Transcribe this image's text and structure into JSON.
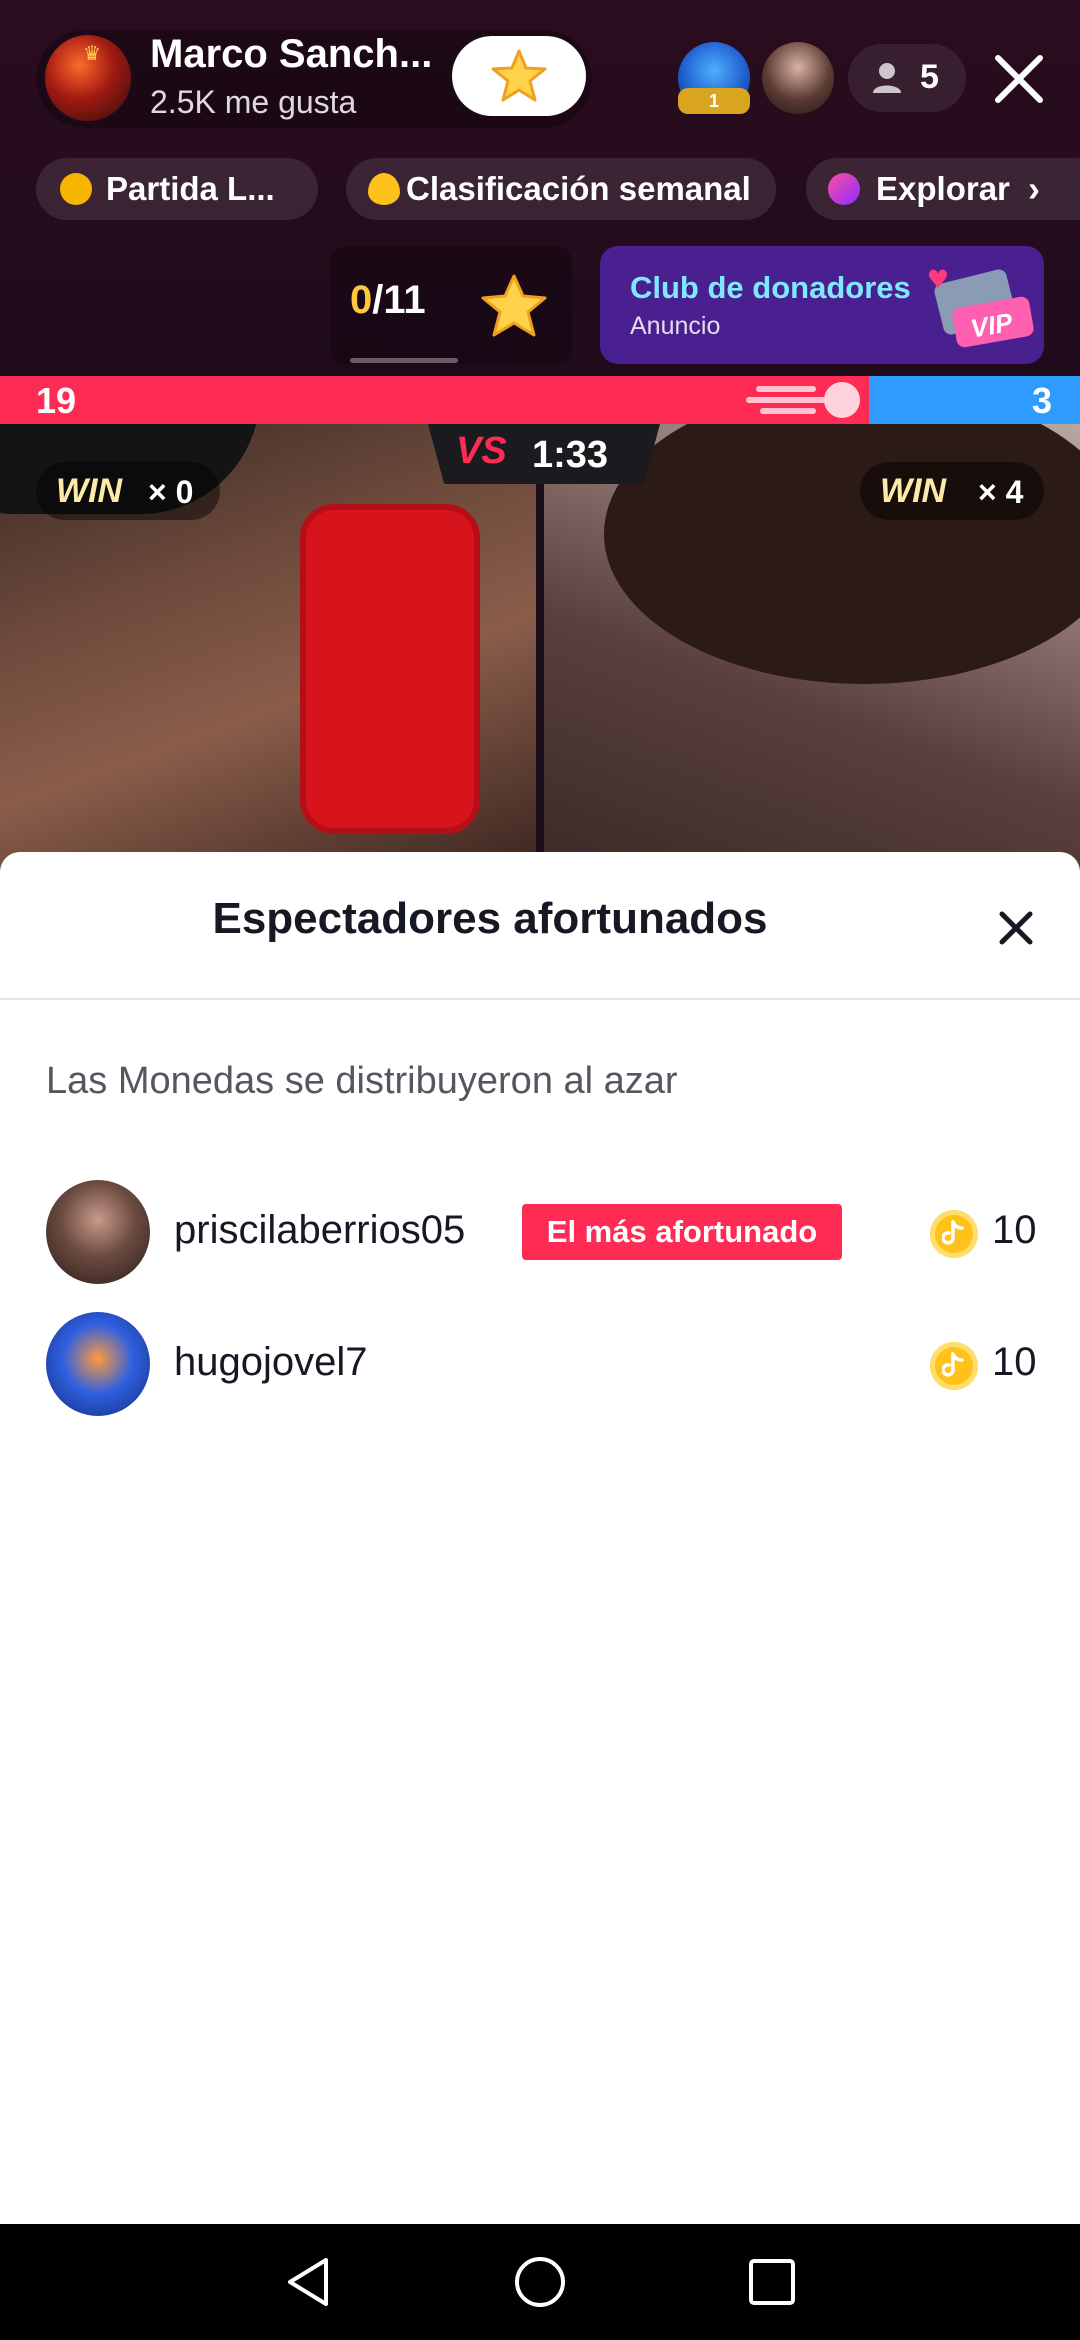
{
  "host": {
    "name": "Marco Sanch...",
    "likes": "2.5K me gusta"
  },
  "viewers": {
    "count": "5",
    "top_badge": "1"
  },
  "chips": [
    {
      "label": "Partida L...",
      "icon": "hashtag-coin-icon"
    },
    {
      "label": "Clasificación semanal",
      "icon": "flame-icon"
    },
    {
      "label": "Explorar",
      "icon": "planet-icon"
    }
  ],
  "goal": {
    "current": "0",
    "total": "/11"
  },
  "club": {
    "title": "Club de donadores",
    "subtitle": "Anuncio",
    "badge": "VIP"
  },
  "battle": {
    "score_left": "19",
    "score_right": "3",
    "score_left_fraction": 0.805,
    "timer": "1:33",
    "vs_label": "VS",
    "left_win_label": "WIN",
    "left_win_count": "× 0",
    "right_win_label": "WIN",
    "right_win_count": "× 4",
    "colors": {
      "left": "#fe2c55",
      "right": "#2f9bff"
    }
  },
  "sheet": {
    "title": "Espectadores afortunados",
    "description": "Las Monedas se distribuyeron al azar",
    "rows": [
      {
        "username": "priscilaberrios05",
        "tag": "El más afortunado",
        "coins": "10"
      },
      {
        "username": "hugojovel7",
        "tag": "",
        "coins": "10"
      }
    ]
  },
  "colors": {
    "accent": "#fe2c55",
    "coin": "#ffc21a"
  }
}
